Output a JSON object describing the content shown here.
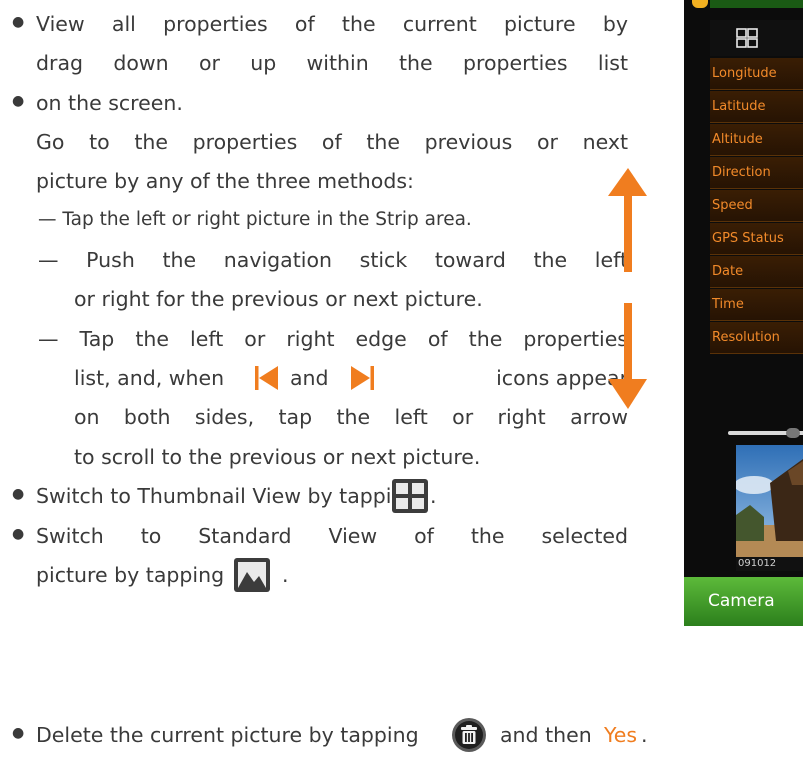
{
  "text_lines": {
    "l1": "View all properties of the current picture by",
    "l2": "drag down or up within the properties list",
    "l3": "on the screen.",
    "l4": "Go to the properties of the previous or next",
    "l5": "picture by any of the three methods:",
    "l6": "— Tap the left or right picture in the Strip area.",
    "l7": "— Push the navigation stick toward the left",
    "l8": "or right for the previous or next picture.",
    "l9": "— Tap the left or right edge of the properties",
    "l10a": "list, and, when",
    "l10b": "and",
    "l10c": "icons appear",
    "l11": "on both sides, tap the left or right arrow",
    "l12": "to scroll to the previous or next picture.",
    "l13": "Switch to Thumbnail View by tapping",
    "l13end": ".",
    "l14": "Switch to Standard View of the selected",
    "l15": "picture by tapping",
    "l15end": ".",
    "l16a": "Delete the current picture by tapping",
    "l16b": "and then",
    "l16yes": "Yes",
    "l16end": "."
  },
  "bullet": "●",
  "device": {
    "properties": [
      "Longitude",
      "Latitude",
      "Altitude",
      "Direction",
      "Speed",
      "GPS Status",
      "Date",
      "Time",
      "Resolution"
    ],
    "filename": "091012",
    "bottom_bar": "Camera"
  },
  "icons": {
    "prev": "prev-arrow-icon",
    "next": "next-arrow-icon",
    "thumbnail": "thumbnail-grid-icon",
    "standard": "picture-icon",
    "delete": "trash-icon",
    "scroll_up": "arrow-up-icon",
    "scroll_down": "arrow-down-icon"
  },
  "colors": {
    "accent": "#f07d1f",
    "text": "#3a3a3a",
    "device_green": "#2c7f1c",
    "property_text": "#f28a2a"
  }
}
